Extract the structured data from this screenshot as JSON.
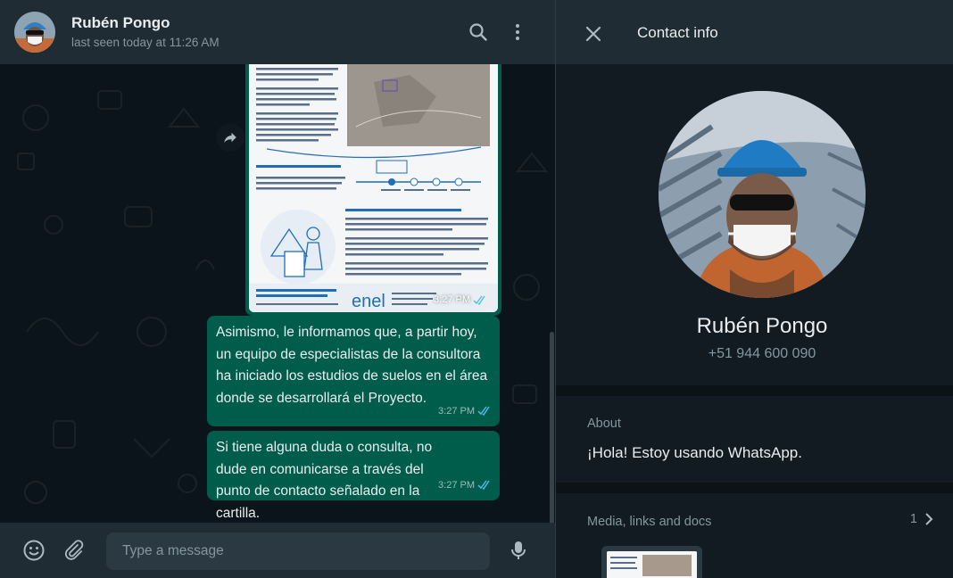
{
  "chat": {
    "contact_name": "Rubén Pongo",
    "status": "last seen today at 11:26 AM",
    "messages": [
      {
        "type": "image",
        "time": "3:27 PM",
        "brand": "enel"
      },
      {
        "type": "text",
        "text": "Asimismo, le informamos que, a partir hoy, un equipo de especialistas de la consultora ha iniciado los estudios de suelos en el área donde se desarrollará el Proyecto.",
        "time": "3:27 PM"
      },
      {
        "type": "text",
        "text": "Si tiene alguna duda o consulta, no dude en comunicarse a través del punto de contacto señalado en la cartilla.",
        "time": "3:27 PM"
      }
    ],
    "input_placeholder": "Type a message"
  },
  "contact_info": {
    "title": "Contact info",
    "name": "Rubén Pongo",
    "phone": "+51 944 600 090",
    "about_label": "About",
    "about_text": "¡Hola! Estoy usando WhatsApp.",
    "media_label": "Media, links and docs",
    "media_count": "1"
  },
  "icons": {
    "search": "search-icon",
    "menu": "menu-dots-icon",
    "emoji": "emoji-icon",
    "attach": "paperclip-icon",
    "mic": "microphone-icon",
    "close": "close-icon",
    "forward": "forward-icon",
    "chevron": "chevron-right-icon",
    "read_receipt": "double-check-icon"
  },
  "colors": {
    "header_bg": "#202c33",
    "chat_bg": "#0b141a",
    "outgoing_bubble": "#005c4b",
    "panel_bg": "#111b21",
    "secondary_text": "#8696a0",
    "read_tick": "#53bdeb"
  }
}
